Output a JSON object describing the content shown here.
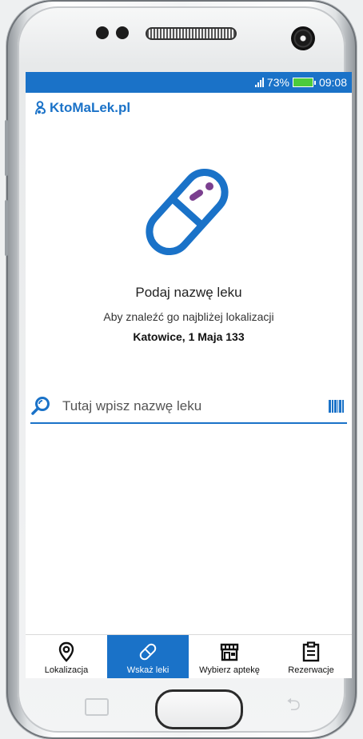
{
  "status_bar": {
    "battery_percent": "73%",
    "time": "09:08"
  },
  "brand": {
    "name": "KtoMaLek.pl"
  },
  "main": {
    "title": "Podaj nazwę leku",
    "subtitle": "Aby znaleźć go najbliżej lokalizacji",
    "location": "Katowice, 1 Maja 133"
  },
  "search": {
    "placeholder": "Tutaj wpisz nazwę leku",
    "value": ""
  },
  "bottom_nav": {
    "items": [
      {
        "label": "Lokalizacja",
        "icon": "map-pin-icon",
        "active": false
      },
      {
        "label": "Wskaż leki",
        "icon": "pill-icon",
        "active": true
      },
      {
        "label": "Wybierz aptekę",
        "icon": "store-icon",
        "active": false
      },
      {
        "label": "Rezerwacje",
        "icon": "clipboard-icon",
        "active": false
      }
    ]
  },
  "colors": {
    "accent": "#1a72c8",
    "pill_dot": "#7b3f8f",
    "battery": "#4ccb3c"
  }
}
